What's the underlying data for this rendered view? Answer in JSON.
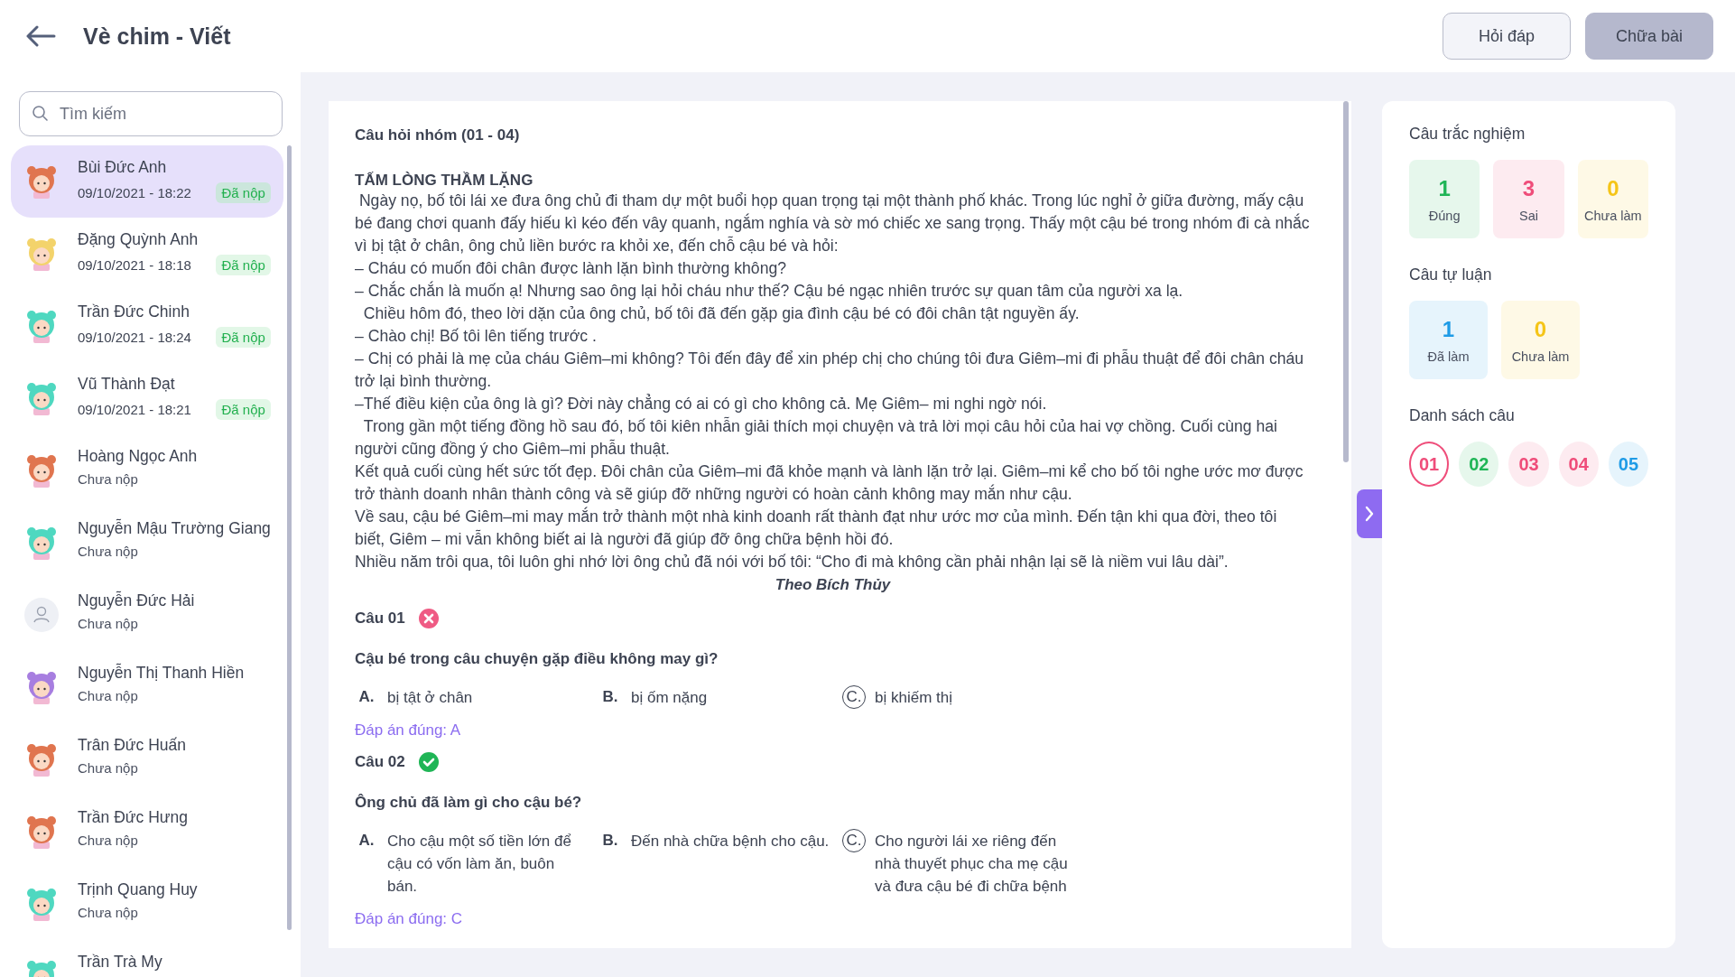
{
  "header": {
    "title": "Vè chim - Viết",
    "buttons": [
      {
        "label": "Hỏi đáp",
        "kind": "outline"
      },
      {
        "label": "Chữa bài",
        "kind": "filled"
      }
    ]
  },
  "sidebar": {
    "search": {
      "placeholder": "Tìm kiếm"
    },
    "students": [
      {
        "name": "Bùi Đức Anh",
        "time": "09/10/2021 - 18:22",
        "status": "Đã nộp",
        "selected": true,
        "avatar": {
          "kind": "character",
          "color": "#e0754f"
        }
      },
      {
        "name": "Đặng Quỳnh Anh",
        "time": "09/10/2021 - 18:18",
        "status": "Đã nộp",
        "selected": false,
        "avatar": {
          "kind": "character",
          "color": "#f3d36b"
        }
      },
      {
        "name": "Trần Đức Chinh",
        "time": "09/10/2021 - 18:24",
        "status": "Đã nộp",
        "selected": false,
        "avatar": {
          "kind": "character",
          "color": "#4fd8c0"
        }
      },
      {
        "name": "Vũ Thành Đạt",
        "time": "09/10/2021 - 18:21",
        "status": "Đã nộp",
        "selected": false,
        "avatar": {
          "kind": "character",
          "color": "#4fd8c0"
        }
      },
      {
        "name": "Hoàng Ngọc Anh",
        "status": "Chưa nộp",
        "selected": false,
        "avatar": {
          "kind": "character",
          "color": "#e0754f"
        }
      },
      {
        "name": "Nguyễn Mậu Trường Giang",
        "status": "Chưa nộp",
        "selected": false,
        "avatar": {
          "kind": "character",
          "color": "#4fd8c0"
        }
      },
      {
        "name": "Nguyễn Đức Hải",
        "status": "Chưa nộp",
        "selected": false,
        "avatar": {
          "kind": "default"
        }
      },
      {
        "name": "Nguyễn Thị Thanh Hiền",
        "status": "Chưa nộp",
        "selected": false,
        "avatar": {
          "kind": "character",
          "color": "#a77ee0"
        }
      },
      {
        "name": "Trân Đức Huấn",
        "status": "Chưa nộp",
        "selected": false,
        "avatar": {
          "kind": "character",
          "color": "#e0754f"
        }
      },
      {
        "name": "Trần Đức Hưng",
        "status": "Chưa nộp",
        "selected": false,
        "avatar": {
          "kind": "character",
          "color": "#e0754f"
        }
      },
      {
        "name": "Trịnh Quang Huy",
        "status": "Chưa nộp",
        "selected": false,
        "avatar": {
          "kind": "character",
          "color": "#4fd8c0"
        }
      },
      {
        "name": "Trần Trà My",
        "selected": false,
        "avatar": {
          "kind": "character",
          "color": "#4fd8c0"
        }
      }
    ]
  },
  "reading": {
    "group_title": "Câu hỏi nhóm (01 - 04)",
    "story_title": "TẤM LÒNG THẦM LẶNG",
    "paragraphs": [
      " Ngày nọ, bố tôi lái xe đưa ông chủ đi tham dự một buổi họp quan trọng tại một thành phố khác. Trong lúc nghỉ ở giữa đường, mấy cậu bé đang chơi quanh đấy hiếu kì kéo đến vây quanh, ngắm nghía và sờ mó chiếc xe sang trọng. Thấy một cậu bé trong nhóm đi cà nhắc vì bị tật ở chân, ông chủ liền bước ra khỏi xe, đến chỗ cậu bé và hỏi:",
      "– Cháu có muốn đôi chân được lành lặn bình thường không?",
      "– Chắc chắn là muốn ạ! Nhưng sao ông lại hỏi cháu như thế? Cậu bé ngạc nhiên trước sự quan tâm của người xa lạ.",
      "  Chiều hôm đó, theo lời dặn của ông chủ, bố tôi đã đến gặp gia đình cậu bé có đôi chân tật nguyền ấy.",
      "– Chào chị! Bố tôi lên tiếng trước .",
      "– Chị có phải là mẹ của cháu Giêm–mi không? Tôi đến đây để xin phép chị cho chúng tôi đưa Giêm–mi đi phẫu thuật để đôi chân cháu trở lại bình thường.",
      "–Thế điều kiện của ông là gì? Đời này chẳng có ai có gì cho không cả. Mẹ Giêm– mi nghi ngờ nói.",
      "  Trong gần một tiếng đồng hồ sau đó, bố tôi kiên nhẫn giải thích mọi chuyện và trả lời mọi câu hỏi của hai vợ chồng. Cuối cùng hai người cũng đồng ý cho Giêm–mi phẫu thuật.",
      "Kết quả cuối cùng hết sức tốt đẹp. Đôi chân của Giêm–mi đã khỏe mạnh và lành lặn trở lại. Giêm–mi kể cho bố tôi nghe ước mơ được trở thành doanh nhân thành công và sẽ giúp đỡ những người có hoàn cảnh không may mắn như cậu.",
      "Về sau, cậu bé Giêm–mi may mắn trở thành một nhà kinh doanh rất thành đạt như ước mơ của mình. Đến tận khi qua đời, theo tôi biết, Giêm – mi vẫn không biết ai là người đã giúp đỡ ông chữa bệnh hồi đó.",
      "Nhiều năm trôi qua, tôi luôn ghi nhớ lời ông chủ đã nói với bố tôi: “Cho đi mà không cần phải nhận lại sẽ là niềm vui lâu dài”."
    ],
    "source": "Theo Bích Thủy",
    "questions": [
      {
        "label": "Câu 01",
        "correct": false,
        "prompt": "Cậu bé trong câu chuyện gặp điều không may gì?",
        "options": [
          {
            "letter": "A.",
            "text": "bị tật ở chân",
            "selected": false
          },
          {
            "letter": "B.",
            "text": "bị ốm nặng",
            "selected": false
          },
          {
            "letter": "C.",
            "text": "bị khiếm thị",
            "selected": true
          }
        ],
        "answer": "Đáp án đúng: A"
      },
      {
        "label": "Câu 02",
        "correct": true,
        "prompt": "Ông chủ đã làm gì cho cậu bé?",
        "options": [
          {
            "letter": "A.",
            "text": "Cho cậu một số tiền lớn để cậu có vốn làm ăn, buôn bán.",
            "selected": false
          },
          {
            "letter": "B.",
            "text": "Đến nhà chữa bệnh cho cậu.",
            "selected": false
          },
          {
            "letter": "C.",
            "text": "Cho người lái xe riêng đến nhà thuyết phục cha mẹ cậu và đưa cậu bé đi chữa bệnh",
            "selected": true
          }
        ],
        "answer": "Đáp án đúng: C"
      }
    ]
  },
  "summary": {
    "groups": [
      {
        "title": "Câu trắc nghiệm",
        "tiles": [
          {
            "value": "1",
            "label": "Đúng",
            "color": "#1fb556"
          },
          {
            "value": "3",
            "label": "Sai",
            "color": "#ef4d7a"
          },
          {
            "value": "0",
            "label": "Chưa làm",
            "color": "#f5c518"
          }
        ]
      },
      {
        "title": "Câu tự luận",
        "tiles": [
          {
            "value": "1",
            "label": "Đã làm",
            "color": "#1e9be6"
          },
          {
            "value": "0",
            "label": "Chưa làm",
            "color": "#f5c518"
          }
        ]
      }
    ],
    "list_title": "Danh sách câu",
    "chips": [
      {
        "label": "01",
        "color": "#ef4d7a",
        "selected": true
      },
      {
        "label": "02",
        "color": "#1fb556",
        "selected": false
      },
      {
        "label": "03",
        "color": "#ef4d7a",
        "selected": false
      },
      {
        "label": "04",
        "color": "#ef4d7a",
        "selected": false
      },
      {
        "label": "05",
        "color": "#1e9be6",
        "selected": false
      }
    ]
  }
}
